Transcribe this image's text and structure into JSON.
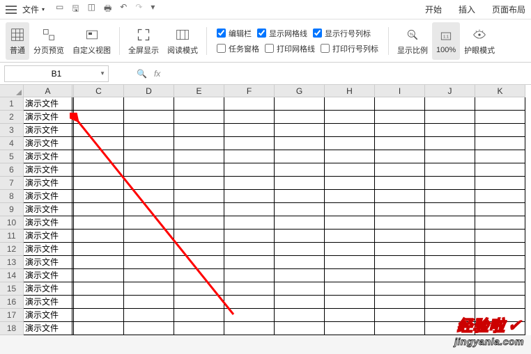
{
  "titlebar": {
    "file_label": "文件",
    "tabs": {
      "start": "开始",
      "insert": "插入",
      "page_layout": "页面布局"
    }
  },
  "ribbon": {
    "normal": "普通",
    "page_break": "分页预览",
    "custom_view": "自定义视图",
    "fullscreen": "全屏显示",
    "read_mode": "阅读模式",
    "edit_bar": "编辑栏",
    "gridlines": "显示网格线",
    "show_rowcol": "显示行号列标",
    "task_pane": "任务窗格",
    "print_grid": "打印网格线",
    "print_rowcol": "打印行号列标",
    "zoom": "显示比例",
    "hundred": "100%",
    "eye_care": "护眼模式"
  },
  "formula": {
    "cell_ref": "B1",
    "fx": "fx"
  },
  "columns": [
    "A",
    "C",
    "D",
    "E",
    "F",
    "G",
    "H",
    "I",
    "J",
    "K"
  ],
  "rows": [
    {
      "n": "1",
      "a": "演示文件"
    },
    {
      "n": "2",
      "a": "演示文件"
    },
    {
      "n": "3",
      "a": "演示文件"
    },
    {
      "n": "4",
      "a": "演示文件"
    },
    {
      "n": "5",
      "a": "演示文件"
    },
    {
      "n": "6",
      "a": "演示文件"
    },
    {
      "n": "7",
      "a": "演示文件"
    },
    {
      "n": "8",
      "a": "演示文件"
    },
    {
      "n": "9",
      "a": "演示文件"
    },
    {
      "n": "10",
      "a": "演示文件"
    },
    {
      "n": "11",
      "a": "演示文件"
    },
    {
      "n": "12",
      "a": "演示文件"
    },
    {
      "n": "13",
      "a": "演示文件"
    },
    {
      "n": "14",
      "a": "演示文件"
    },
    {
      "n": "15",
      "a": "演示文件"
    },
    {
      "n": "16",
      "a": "演示文件"
    },
    {
      "n": "17",
      "a": "演示文件"
    },
    {
      "n": "18",
      "a": "演示文件"
    }
  ],
  "watermark": {
    "top": "经验啦",
    "bottom": "jingyanla.com"
  }
}
